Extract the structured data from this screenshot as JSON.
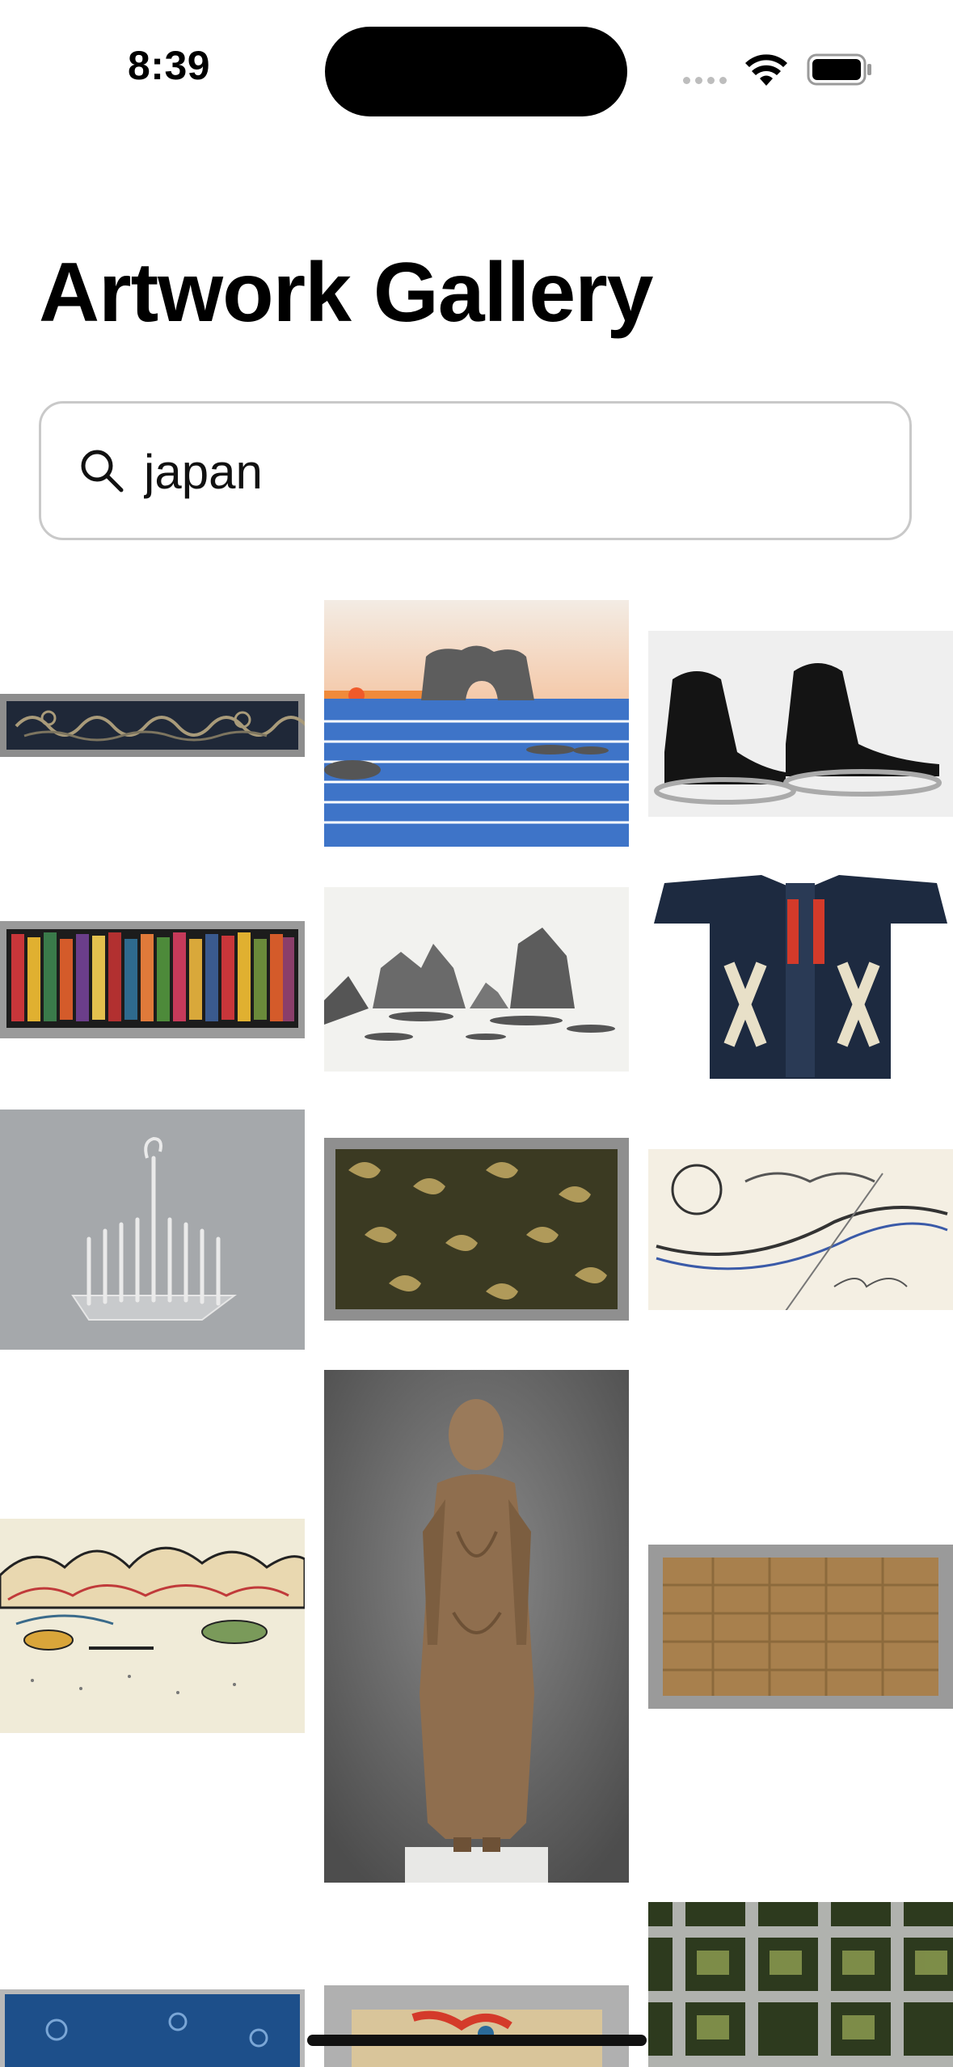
{
  "status_bar": {
    "time": "8:39"
  },
  "header": {
    "title": "Artwork Gallery"
  },
  "search": {
    "value": "japan",
    "placeholder": "Search"
  },
  "gallery": {
    "items": [
      {
        "name": "dragon-textile-panel"
      },
      {
        "name": "coastal-rock-arch-print"
      },
      {
        "name": "black-tabi-sandals-photo"
      },
      {
        "name": "striped-woven-textile"
      },
      {
        "name": "misty-rocky-coast-print"
      },
      {
        "name": "firefighter-happi-coat"
      },
      {
        "name": "silver-rack-sculpture"
      },
      {
        "name": "gold-brocade-textile"
      },
      {
        "name": "sketch-drawing"
      },
      {
        "name": "landscape-ink-watercolor"
      },
      {
        "name": "standing-buddha-sculpture"
      },
      {
        "name": "brown-woven-textile"
      },
      {
        "name": "blue-textile-fragment"
      },
      {
        "name": "painted-panel"
      },
      {
        "name": "green-plaid-textile"
      }
    ]
  }
}
